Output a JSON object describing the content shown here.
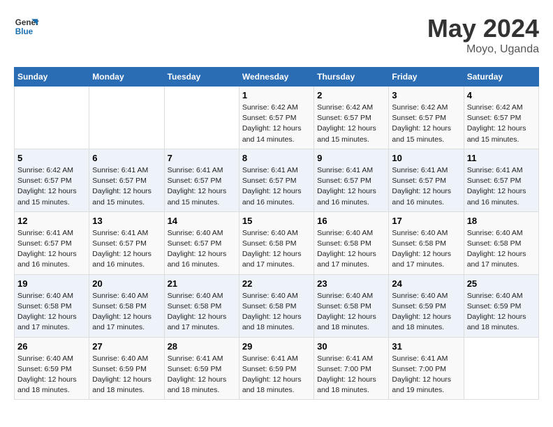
{
  "header": {
    "logo_line1": "General",
    "logo_line2": "Blue",
    "month": "May 2024",
    "location": "Moyo, Uganda"
  },
  "weekdays": [
    "Sunday",
    "Monday",
    "Tuesday",
    "Wednesday",
    "Thursday",
    "Friday",
    "Saturday"
  ],
  "weeks": [
    [
      {
        "day": "",
        "info": ""
      },
      {
        "day": "",
        "info": ""
      },
      {
        "day": "",
        "info": ""
      },
      {
        "day": "1",
        "info": "Sunrise: 6:42 AM\nSunset: 6:57 PM\nDaylight: 12 hours and 14 minutes."
      },
      {
        "day": "2",
        "info": "Sunrise: 6:42 AM\nSunset: 6:57 PM\nDaylight: 12 hours and 15 minutes."
      },
      {
        "day": "3",
        "info": "Sunrise: 6:42 AM\nSunset: 6:57 PM\nDaylight: 12 hours and 15 minutes."
      },
      {
        "day": "4",
        "info": "Sunrise: 6:42 AM\nSunset: 6:57 PM\nDaylight: 12 hours and 15 minutes."
      }
    ],
    [
      {
        "day": "5",
        "info": "Sunrise: 6:42 AM\nSunset: 6:57 PM\nDaylight: 12 hours and 15 minutes."
      },
      {
        "day": "6",
        "info": "Sunrise: 6:41 AM\nSunset: 6:57 PM\nDaylight: 12 hours and 15 minutes."
      },
      {
        "day": "7",
        "info": "Sunrise: 6:41 AM\nSunset: 6:57 PM\nDaylight: 12 hours and 15 minutes."
      },
      {
        "day": "8",
        "info": "Sunrise: 6:41 AM\nSunset: 6:57 PM\nDaylight: 12 hours and 16 minutes."
      },
      {
        "day": "9",
        "info": "Sunrise: 6:41 AM\nSunset: 6:57 PM\nDaylight: 12 hours and 16 minutes."
      },
      {
        "day": "10",
        "info": "Sunrise: 6:41 AM\nSunset: 6:57 PM\nDaylight: 12 hours and 16 minutes."
      },
      {
        "day": "11",
        "info": "Sunrise: 6:41 AM\nSunset: 6:57 PM\nDaylight: 12 hours and 16 minutes."
      }
    ],
    [
      {
        "day": "12",
        "info": "Sunrise: 6:41 AM\nSunset: 6:57 PM\nDaylight: 12 hours and 16 minutes."
      },
      {
        "day": "13",
        "info": "Sunrise: 6:41 AM\nSunset: 6:57 PM\nDaylight: 12 hours and 16 minutes."
      },
      {
        "day": "14",
        "info": "Sunrise: 6:40 AM\nSunset: 6:57 PM\nDaylight: 12 hours and 16 minutes."
      },
      {
        "day": "15",
        "info": "Sunrise: 6:40 AM\nSunset: 6:58 PM\nDaylight: 12 hours and 17 minutes."
      },
      {
        "day": "16",
        "info": "Sunrise: 6:40 AM\nSunset: 6:58 PM\nDaylight: 12 hours and 17 minutes."
      },
      {
        "day": "17",
        "info": "Sunrise: 6:40 AM\nSunset: 6:58 PM\nDaylight: 12 hours and 17 minutes."
      },
      {
        "day": "18",
        "info": "Sunrise: 6:40 AM\nSunset: 6:58 PM\nDaylight: 12 hours and 17 minutes."
      }
    ],
    [
      {
        "day": "19",
        "info": "Sunrise: 6:40 AM\nSunset: 6:58 PM\nDaylight: 12 hours and 17 minutes."
      },
      {
        "day": "20",
        "info": "Sunrise: 6:40 AM\nSunset: 6:58 PM\nDaylight: 12 hours and 17 minutes."
      },
      {
        "day": "21",
        "info": "Sunrise: 6:40 AM\nSunset: 6:58 PM\nDaylight: 12 hours and 17 minutes."
      },
      {
        "day": "22",
        "info": "Sunrise: 6:40 AM\nSunset: 6:58 PM\nDaylight: 12 hours and 18 minutes."
      },
      {
        "day": "23",
        "info": "Sunrise: 6:40 AM\nSunset: 6:58 PM\nDaylight: 12 hours and 18 minutes."
      },
      {
        "day": "24",
        "info": "Sunrise: 6:40 AM\nSunset: 6:59 PM\nDaylight: 12 hours and 18 minutes."
      },
      {
        "day": "25",
        "info": "Sunrise: 6:40 AM\nSunset: 6:59 PM\nDaylight: 12 hours and 18 minutes."
      }
    ],
    [
      {
        "day": "26",
        "info": "Sunrise: 6:40 AM\nSunset: 6:59 PM\nDaylight: 12 hours and 18 minutes."
      },
      {
        "day": "27",
        "info": "Sunrise: 6:40 AM\nSunset: 6:59 PM\nDaylight: 12 hours and 18 minutes."
      },
      {
        "day": "28",
        "info": "Sunrise: 6:41 AM\nSunset: 6:59 PM\nDaylight: 12 hours and 18 minutes."
      },
      {
        "day": "29",
        "info": "Sunrise: 6:41 AM\nSunset: 6:59 PM\nDaylight: 12 hours and 18 minutes."
      },
      {
        "day": "30",
        "info": "Sunrise: 6:41 AM\nSunset: 7:00 PM\nDaylight: 12 hours and 18 minutes."
      },
      {
        "day": "31",
        "info": "Sunrise: 6:41 AM\nSunset: 7:00 PM\nDaylight: 12 hours and 19 minutes."
      },
      {
        "day": "",
        "info": ""
      }
    ]
  ]
}
